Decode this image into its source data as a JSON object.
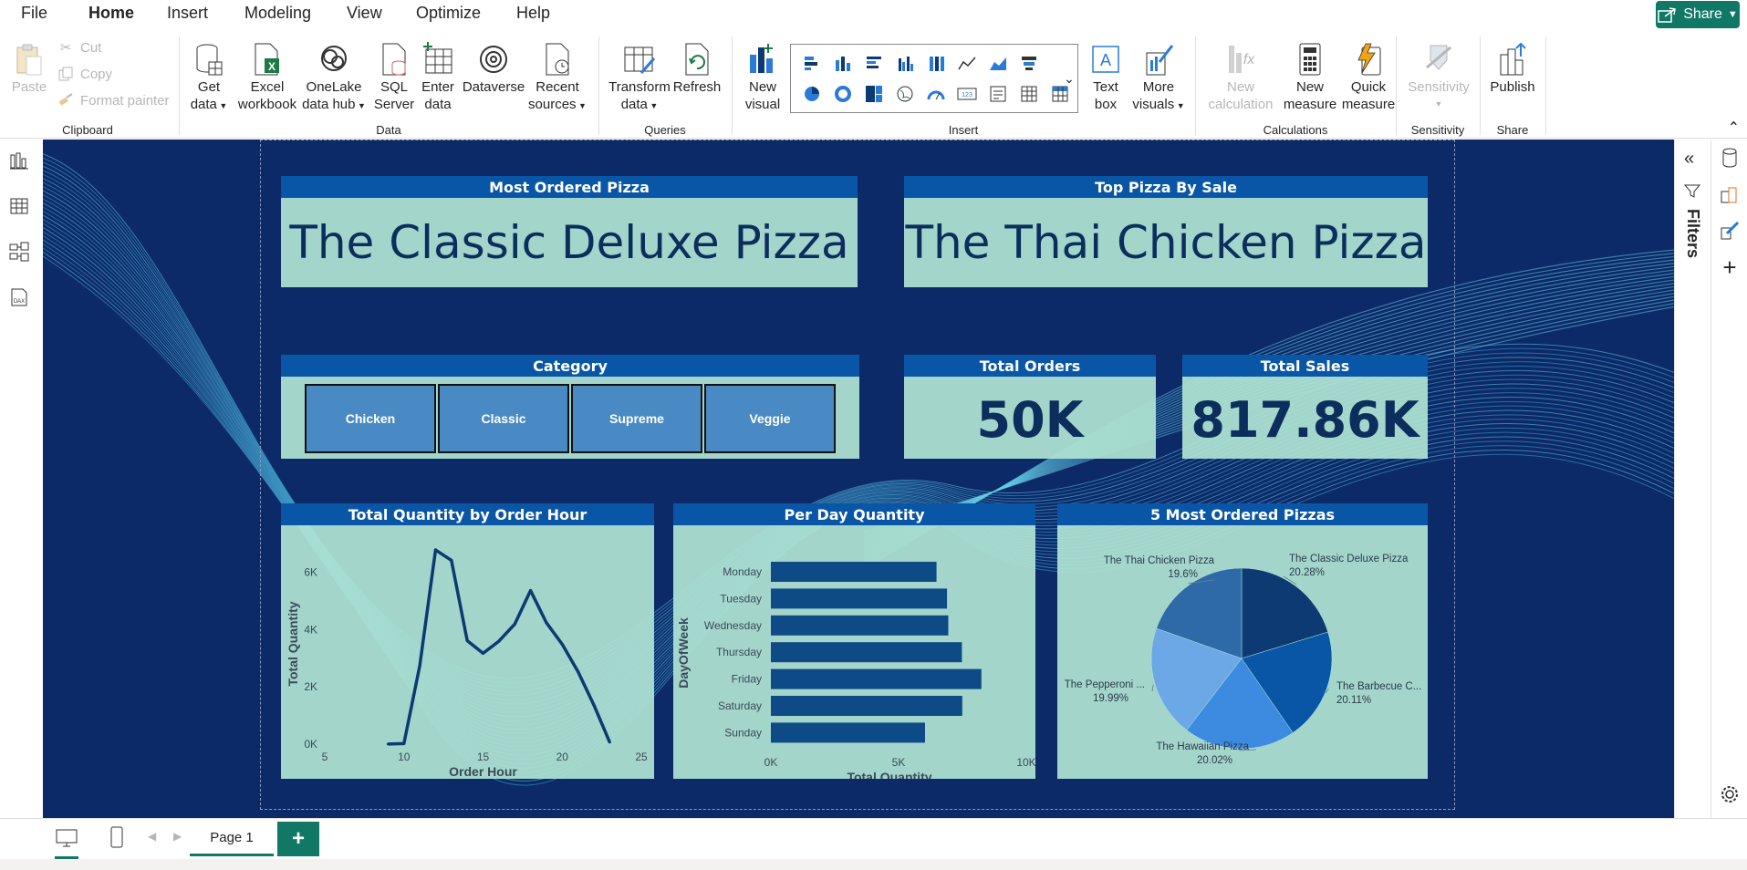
{
  "menu": {
    "items": [
      {
        "label": "File"
      },
      {
        "label": "Home"
      },
      {
        "label": "Insert"
      },
      {
        "label": "Modeling"
      },
      {
        "label": "View"
      },
      {
        "label": "Optimize"
      },
      {
        "label": "Help"
      }
    ],
    "share_label": "Share"
  },
  "ribbon": {
    "clipboard": {
      "paste": "Paste",
      "cut": "Cut",
      "copy": "Copy",
      "format_painter": "Format painter",
      "group": "Clipboard"
    },
    "data": {
      "get_data": [
        "Get",
        "data"
      ],
      "excel": [
        "Excel",
        "workbook"
      ],
      "onelake": [
        "OneLake",
        "data hub"
      ],
      "sql": [
        "SQL",
        "Server"
      ],
      "enter": [
        "Enter",
        "data"
      ],
      "dataverse": "Dataverse",
      "recent": [
        "Recent",
        "sources"
      ],
      "group": "Data"
    },
    "queries": {
      "transform": [
        "Transform",
        "data"
      ],
      "refresh": "Refresh",
      "group": "Queries"
    },
    "insert": {
      "new_visual": [
        "New",
        "visual"
      ],
      "text_box": [
        "Text",
        "box"
      ],
      "more_visuals": [
        "More",
        "visuals"
      ],
      "group": "Insert"
    },
    "calculations": {
      "new_calc": [
        "New",
        "calculation"
      ],
      "new_measure": [
        "New",
        "measure"
      ],
      "quick_measure": [
        "Quick",
        "measure"
      ],
      "group": "Calculations"
    },
    "sensitivity": {
      "label": "Sensitivity",
      "group": "Sensitivity"
    },
    "share": {
      "publish": "Publish",
      "group": "Share"
    }
  },
  "right_pane": {
    "filters_label": "Filters"
  },
  "report": {
    "most_ordered": {
      "title": "Most Ordered Pizza",
      "value": "The Classic Deluxe Pizza"
    },
    "top_by_sale": {
      "title": "Top Pizza By Sale",
      "value": "The Thai Chicken Pizza"
    },
    "category": {
      "title": "Category",
      "options": [
        "Chicken",
        "Classic",
        "Supreme",
        "Veggie"
      ]
    },
    "total_orders": {
      "title": "Total Orders",
      "value": "50K"
    },
    "total_sales": {
      "title": "Total Sales",
      "value": "817.86K"
    },
    "colors": {
      "header": "#0a56a6",
      "card": "#b0e4d4",
      "text": "#0b2e5c",
      "bar": "#0d4a86"
    }
  },
  "chart_data": [
    {
      "type": "line",
      "title": "Total Quantity by Order Hour",
      "xlabel": "Order Hour",
      "ylabel": "Total Quantity",
      "x": [
        9,
        10,
        11,
        12,
        13,
        14,
        15,
        16,
        17,
        18,
        19,
        20,
        21,
        22,
        23
      ],
      "y": [
        4,
        18,
        2730,
        6776,
        6413,
        3613,
        3170,
        3592,
        4185,
        5359,
        4239,
        3487,
        2528,
        1370,
        68
      ],
      "xlim": [
        5,
        25
      ],
      "xticks": [
        "5",
        "10",
        "15",
        "20",
        "25"
      ],
      "ylim": [
        0,
        7000
      ],
      "yticks": [
        "0K",
        "2K",
        "4K",
        "6K"
      ],
      "ytick_values": [
        0,
        2000,
        4000,
        6000
      ]
    },
    {
      "type": "bar",
      "orientation": "horizontal",
      "title": "Per Day Quantity",
      "xlabel": "Total Quantity",
      "ylabel": "DayOfWeek",
      "categories": [
        "Monday",
        "Tuesday",
        "Wednesday",
        "Thursday",
        "Friday",
        "Saturday",
        "Sunday"
      ],
      "values": [
        6485,
        6895,
        6946,
        7478,
        8242,
        7493,
        6035
      ],
      "xlim": [
        0,
        10000
      ],
      "xticks": [
        "0K",
        "5K",
        "10K"
      ],
      "xtick_values": [
        0,
        5000,
        10000
      ]
    },
    {
      "type": "pie",
      "title": "5 Most Ordered Pizzas",
      "slices": [
        {
          "label": "The Classic Deluxe Pizza",
          "pct": "20.28%",
          "value": 20.28,
          "color": "#0d3a72"
        },
        {
          "label": "The Barbecue C...",
          "pct": "20.11%",
          "value": 20.11,
          "color": "#0a56a6"
        },
        {
          "label": "The Hawaiian Pizza",
          "pct": "20.02%",
          "value": 20.02,
          "color": "#3d8be0"
        },
        {
          "label": "The Pepperoni ...",
          "pct": "19.99%",
          "value": 19.99,
          "color": "#6ca8e6"
        },
        {
          "label": "The Thai Chicken Pizza",
          "pct": "19.6%",
          "value": 19.6,
          "color": "#2e6aa8"
        }
      ]
    }
  ],
  "page_tabs": {
    "current": "Page 1",
    "add": "+"
  }
}
